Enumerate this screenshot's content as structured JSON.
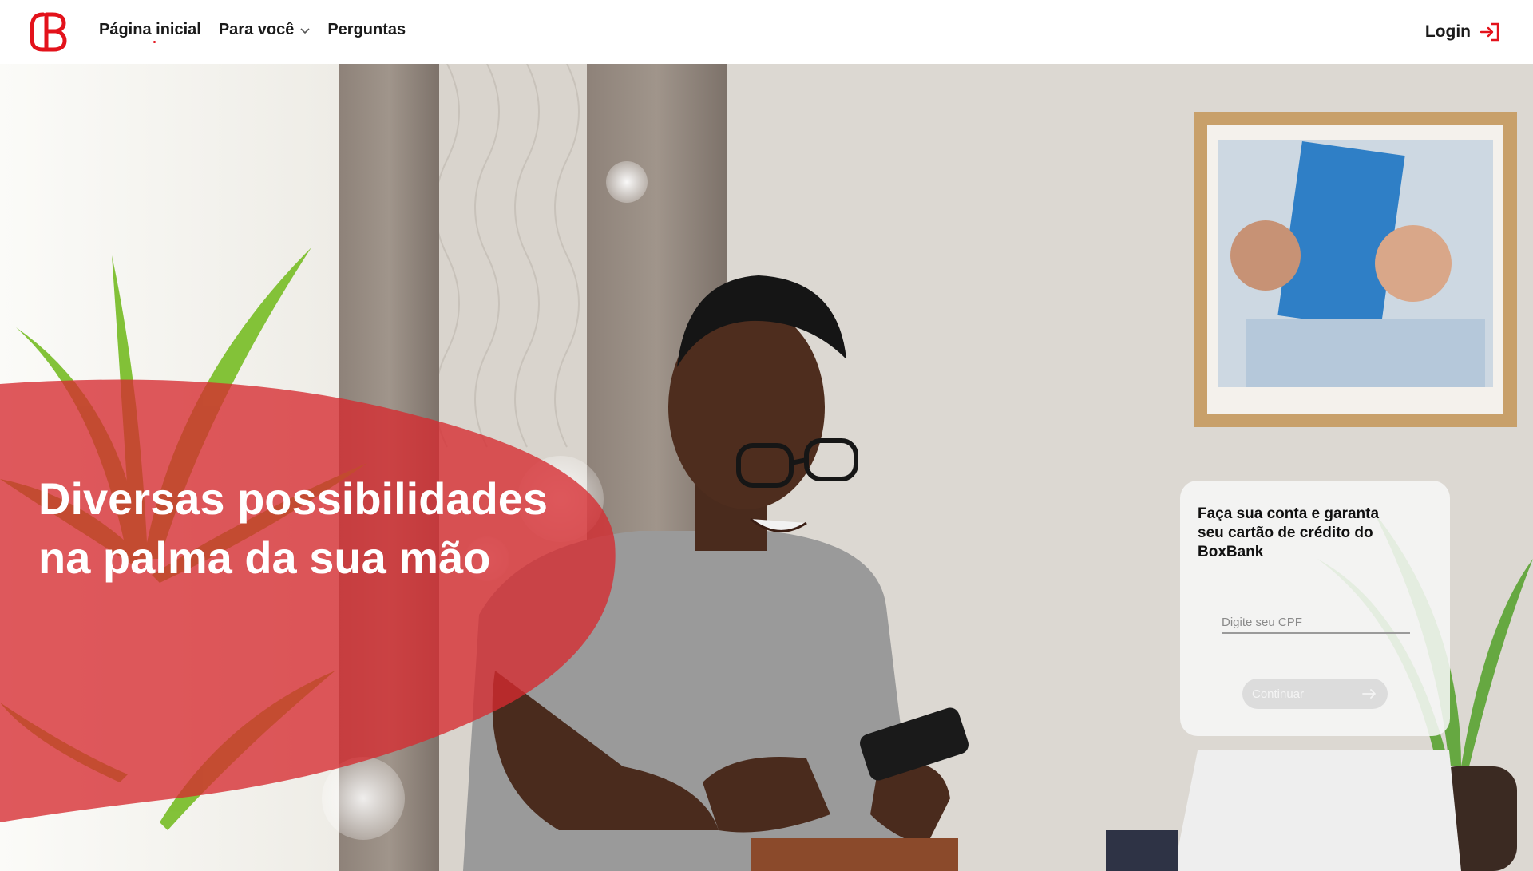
{
  "brand": {
    "name": "BoxBank",
    "accent": "#e3121b"
  },
  "nav": {
    "items": [
      {
        "label": "Página inicial",
        "active": true
      },
      {
        "label": "Para você",
        "has_dropdown": true
      },
      {
        "label": "Perguntas"
      }
    ],
    "login_label": "Login"
  },
  "hero": {
    "headline": "Diversas possibilidades na palma da sua mão",
    "overlay_color": "#d62a2f"
  },
  "signup_card": {
    "title": "Faça sua conta e garanta seu cartão de crédito do BoxBank",
    "cpf_placeholder": "Digite seu CPF",
    "continue_label": "Continuar"
  },
  "icons": [
    "logo-icon",
    "chevron-down-icon",
    "login-arrow-icon",
    "arrow-right-icon"
  ]
}
